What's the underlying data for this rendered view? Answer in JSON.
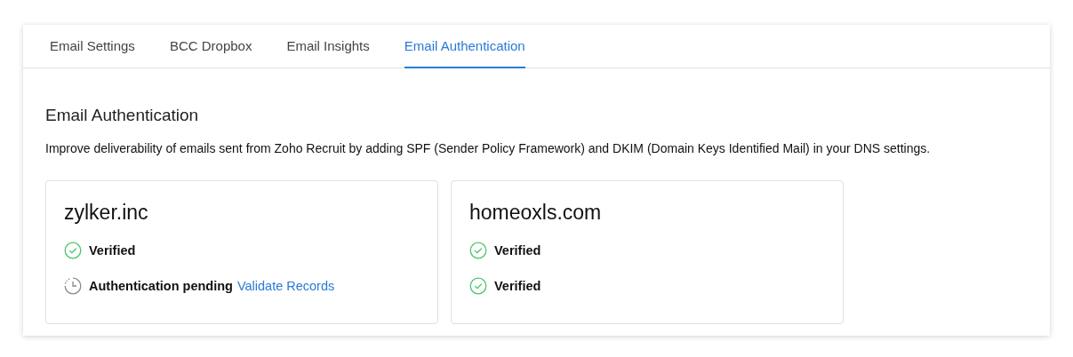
{
  "tabs": [
    {
      "label": "Email Settings",
      "selected": false
    },
    {
      "label": "BCC Dropbox",
      "selected": false
    },
    {
      "label": "Email Insights",
      "selected": false
    },
    {
      "label": "Email Authentication",
      "selected": true
    }
  ],
  "section": {
    "title": "Email Authentication",
    "description": "Improve deliverability of emails sent from Zoho Recruit by adding SPF (Sender Policy Framework) and DKIM (Domain Keys Identified Mail) in your DNS settings."
  },
  "domains": [
    {
      "name": "zylker.inc",
      "records": [
        {
          "kind": "verified",
          "label": "Verified"
        },
        {
          "kind": "pending",
          "label": "Authentication pending",
          "link": "Validate Records"
        }
      ]
    },
    {
      "name": "homeoxls.com",
      "records": [
        {
          "kind": "verified",
          "label": "Verified"
        },
        {
          "kind": "verified",
          "label": "Verified"
        }
      ]
    }
  ]
}
